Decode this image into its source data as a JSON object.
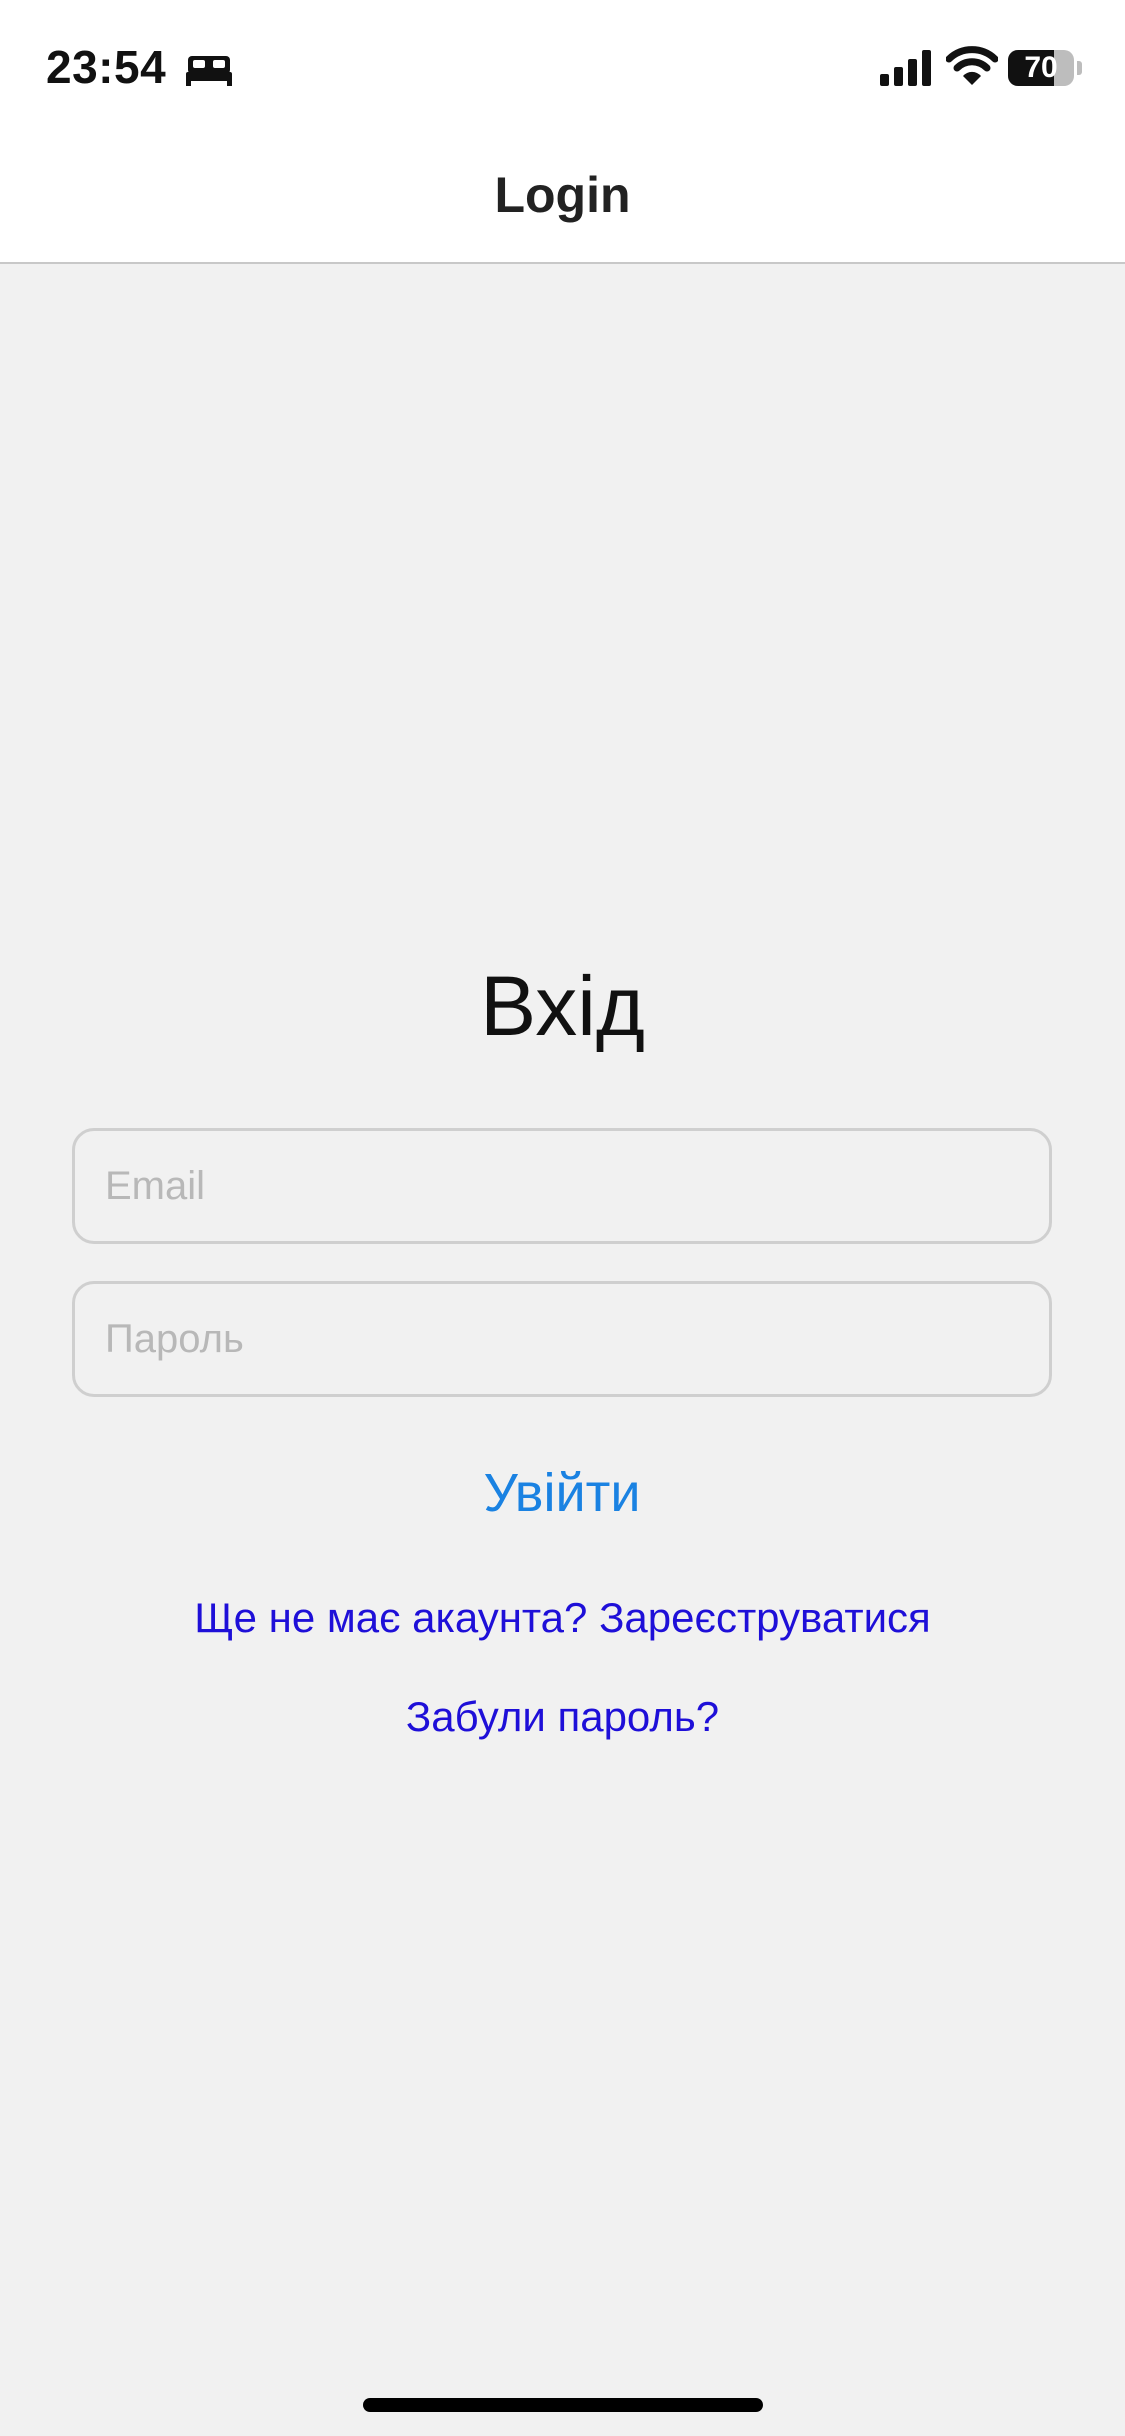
{
  "status_bar": {
    "time": "23:54",
    "focus_icon": "bed-icon",
    "signal_icon": "cellular-signal-icon",
    "wifi_icon": "wifi-icon",
    "battery_level": "70",
    "battery_percent": 70
  },
  "nav": {
    "title": "Login"
  },
  "form": {
    "title": "Вхід",
    "email_placeholder": "Email",
    "password_placeholder": "Пароль",
    "login_label": "Увійти"
  },
  "links": {
    "register": "Ще не має акаунта? Зареєструватися",
    "forgot_password": "Забули пароль?"
  },
  "colors": {
    "background": "#f1f1f1",
    "accent_button": "#1a82e2",
    "link": "#1e0fd8"
  }
}
